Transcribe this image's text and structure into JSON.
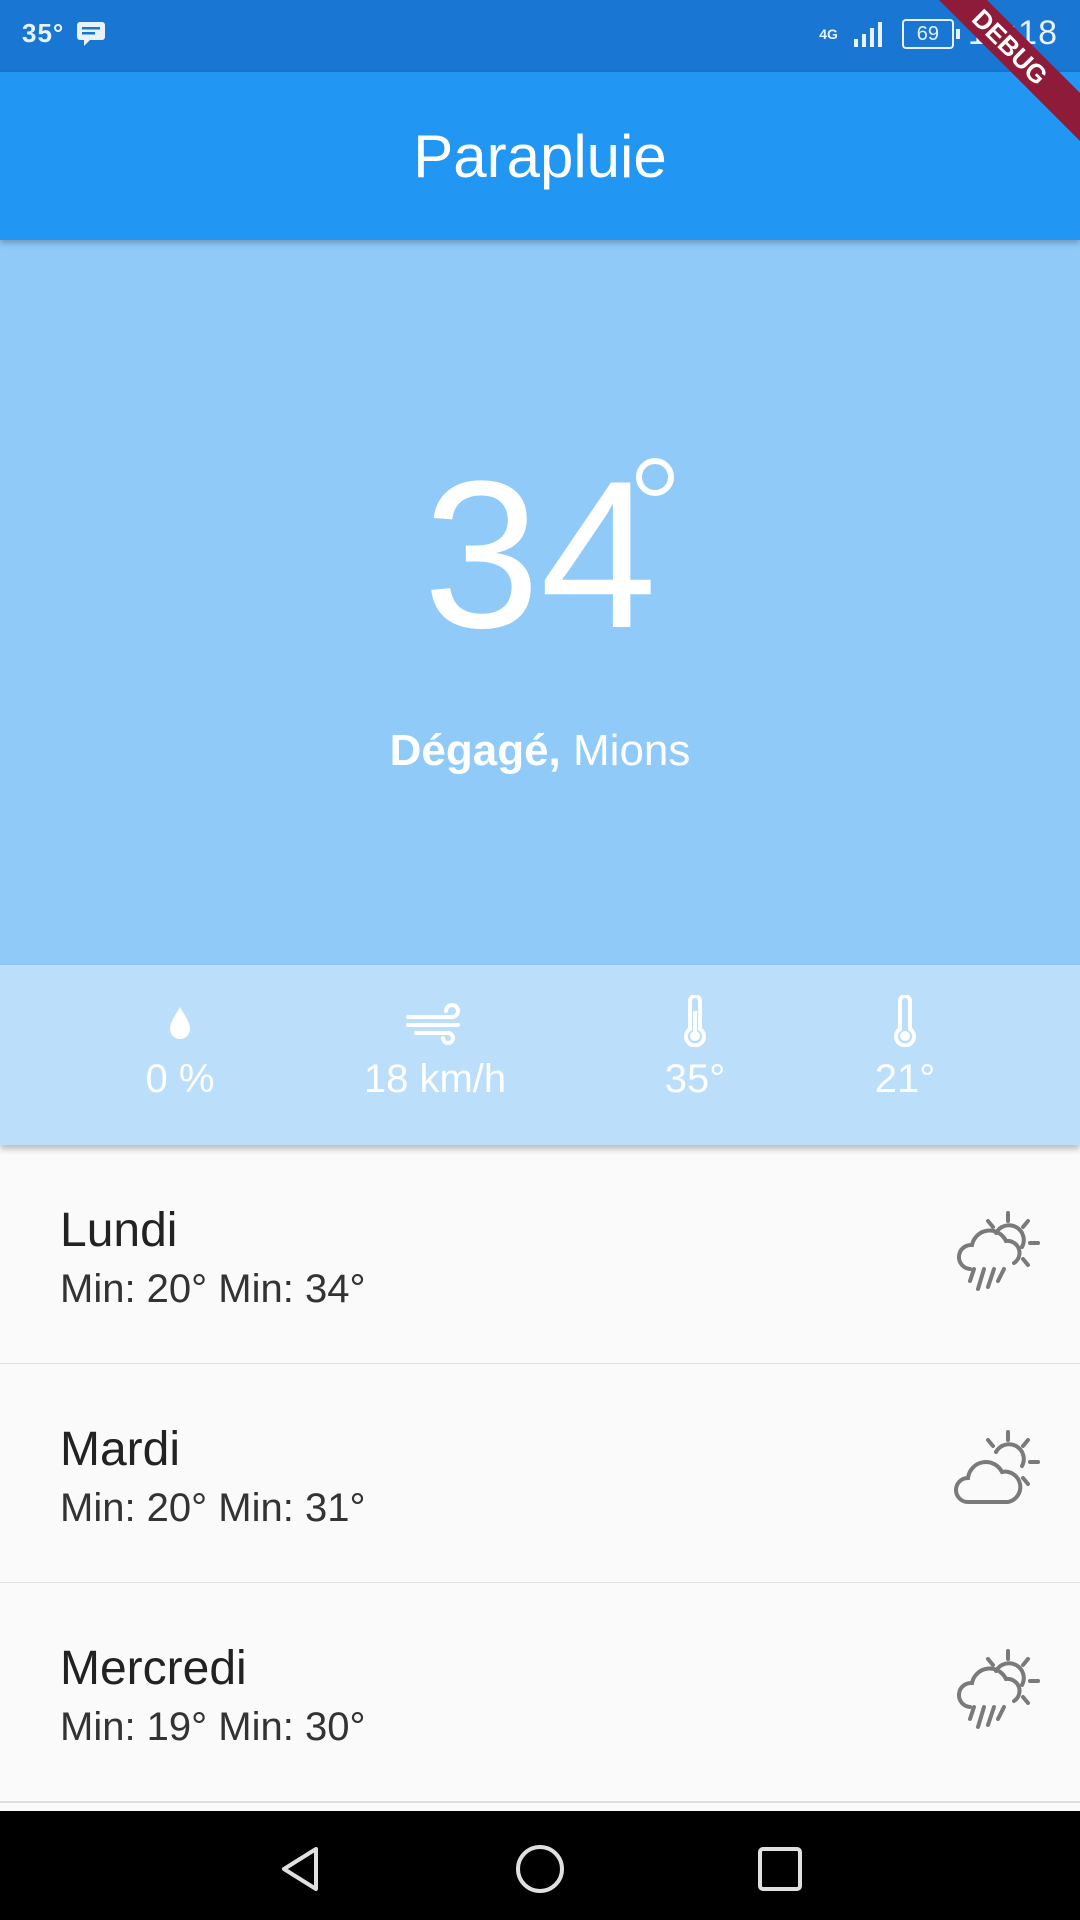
{
  "status_bar": {
    "temp": "35°",
    "network": "4G",
    "battery": "69",
    "time": "19:18"
  },
  "app_bar": {
    "title": "Parapluie"
  },
  "debug_banner": "DEBUG",
  "current": {
    "temperature": "34",
    "condition": "Dégagé,",
    "location": "Mions"
  },
  "stats": [
    {
      "icon": "raindrop-icon",
      "value": "0 %"
    },
    {
      "icon": "wind-icon",
      "value": "18 km/h"
    },
    {
      "icon": "thermometer-icon",
      "value": "35°"
    },
    {
      "icon": "thermometer-icon",
      "value": "21°"
    }
  ],
  "forecast": [
    {
      "day": "Lundi",
      "temps": "Min: 20° Min: 34°",
      "icon": "rain-sun-icon"
    },
    {
      "day": "Mardi",
      "temps": "Min: 20° Min: 31°",
      "icon": "partly-cloudy-icon"
    },
    {
      "day": "Mercredi",
      "temps": "Min: 19° Min: 30°",
      "icon": "rain-sun-icon"
    }
  ],
  "colors": {
    "status_bar": "#1976d2",
    "app_bar": "#2196f3",
    "hero": "#90caf9",
    "stats": "#bbdefb"
  }
}
